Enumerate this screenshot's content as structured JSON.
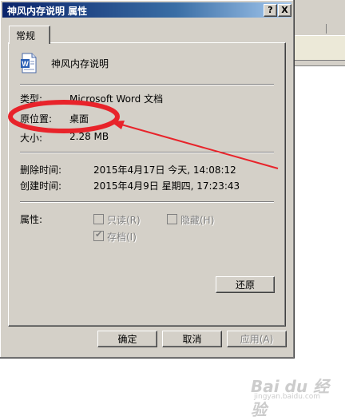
{
  "window": {
    "title": "神风内存说明 属性"
  },
  "titlebar_buttons": {
    "help": "?",
    "close": "X"
  },
  "tabs": [
    {
      "label": "常规"
    }
  ],
  "file": {
    "name": "神风内存说明",
    "icon": "word-document-icon"
  },
  "fields": {
    "type_label": "类型:",
    "type_value": "Microsoft Word 文档",
    "location_label": "原位置:",
    "location_value": "桌面",
    "size_label": "大小:",
    "size_value": "2.28 MB",
    "deleted_label": "删除时间:",
    "deleted_value": "2015年4月17日 今天, 14:08:12",
    "created_label": "创建时间:",
    "created_value": "2015年4月9日 星期四, 17:23:43"
  },
  "attributes": {
    "label": "属性:",
    "readonly": "只读(R)",
    "hidden": "隐藏(H)",
    "archive": "存档(I)"
  },
  "buttons": {
    "restore": "还原",
    "ok": "确定",
    "cancel": "取消",
    "apply": "应用(A)"
  },
  "colors": {
    "annotation": "#e8232a",
    "titlebar": "#0a246a"
  },
  "watermark": {
    "text": "Bai du 经验",
    "sub": "jingyan.baidu.com"
  }
}
